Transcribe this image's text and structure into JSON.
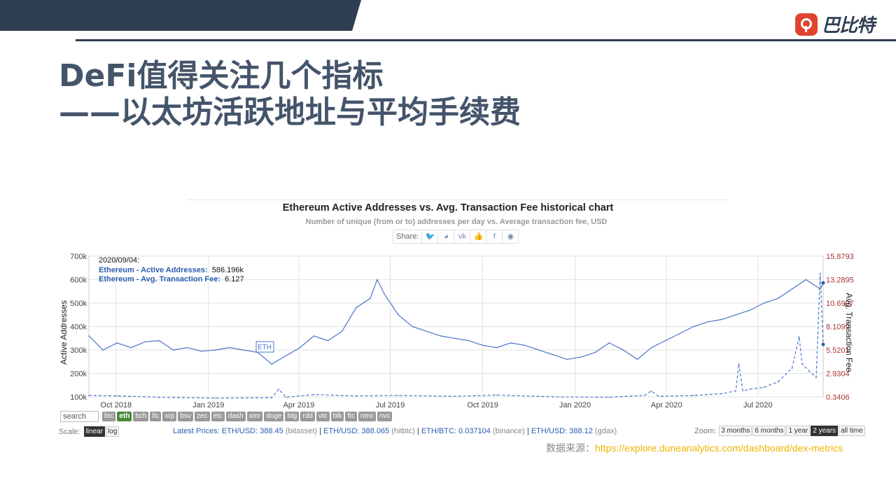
{
  "slide": {
    "title_line1": "DeFi值得关注几个指标",
    "title_line2": "——以太坊活跃地址与平均手续费",
    "logo_text": "巴比特",
    "accent_color": "#2f3d52",
    "logo_color": "#e0442e"
  },
  "chart_data": {
    "type": "line",
    "title": "Ethereum Active Addresses vs. Avg. Transaction Fee historical chart",
    "subtitle": "Number of unique (from or to) addresses per day vs. Average transaction fee, USD",
    "ylabel": "Active Addresses",
    "y2label": "Avg. Transaction Fee",
    "y_ticks": [
      "100k",
      "200k",
      "300k",
      "400k",
      "500k",
      "600k",
      "700k"
    ],
    "y_range": [
      100000,
      700000
    ],
    "y2_ticks": [
      "0.3406",
      "2.9304",
      "5.5201",
      "8.1099",
      "10.6997",
      "13.2895",
      "15.8793"
    ],
    "y2_range": [
      0.3406,
      15.8793
    ],
    "x_ticks": [
      "Oct 2018",
      "Jan 2019",
      "Apr 2019",
      "Jul 2019",
      "Oct 2019",
      "Jan 2020",
      "Apr 2020",
      "Jul 2020"
    ],
    "x_range": [
      "2018-09-04",
      "2020-09-04"
    ],
    "grid": true,
    "series": [
      {
        "name": "Ethereum - Active Addresses",
        "color": "#4a74c9",
        "style": "solid",
        "axis": "left",
        "points": [
          [
            "2018-09-04",
            360000
          ],
          [
            "2018-09-18",
            300000
          ],
          [
            "2018-10-02",
            330000
          ],
          [
            "2018-10-16",
            310000
          ],
          [
            "2018-10-30",
            335000
          ],
          [
            "2018-11-13",
            340000
          ],
          [
            "2018-11-27",
            300000
          ],
          [
            "2018-12-11",
            310000
          ],
          [
            "2018-12-25",
            295000
          ],
          [
            "2019-01-08",
            300000
          ],
          [
            "2019-01-22",
            310000
          ],
          [
            "2019-02-05",
            300000
          ],
          [
            "2019-02-19",
            290000
          ],
          [
            "2019-03-05",
            240000
          ],
          [
            "2019-03-19",
            275000
          ],
          [
            "2019-04-02",
            310000
          ],
          [
            "2019-04-16",
            360000
          ],
          [
            "2019-04-30",
            340000
          ],
          [
            "2019-05-14",
            380000
          ],
          [
            "2019-05-28",
            480000
          ],
          [
            "2019-06-11",
            520000
          ],
          [
            "2019-06-18",
            600000
          ],
          [
            "2019-06-25",
            540000
          ],
          [
            "2019-07-09",
            450000
          ],
          [
            "2019-07-23",
            400000
          ],
          [
            "2019-08-06",
            380000
          ],
          [
            "2019-08-20",
            360000
          ],
          [
            "2019-09-03",
            350000
          ],
          [
            "2019-09-17",
            340000
          ],
          [
            "2019-10-01",
            320000
          ],
          [
            "2019-10-15",
            310000
          ],
          [
            "2019-10-29",
            330000
          ],
          [
            "2019-11-12",
            320000
          ],
          [
            "2019-11-26",
            300000
          ],
          [
            "2019-12-10",
            280000
          ],
          [
            "2019-12-24",
            260000
          ],
          [
            "2020-01-07",
            270000
          ],
          [
            "2020-01-21",
            290000
          ],
          [
            "2020-02-04",
            330000
          ],
          [
            "2020-02-18",
            300000
          ],
          [
            "2020-03-03",
            260000
          ],
          [
            "2020-03-17",
            310000
          ],
          [
            "2020-03-31",
            340000
          ],
          [
            "2020-04-14",
            370000
          ],
          [
            "2020-04-28",
            400000
          ],
          [
            "2020-05-12",
            420000
          ],
          [
            "2020-05-26",
            430000
          ],
          [
            "2020-06-09",
            450000
          ],
          [
            "2020-06-23",
            470000
          ],
          [
            "2020-07-07",
            500000
          ],
          [
            "2020-07-21",
            520000
          ],
          [
            "2020-08-04",
            560000
          ],
          [
            "2020-08-18",
            600000
          ],
          [
            "2020-09-01",
            560000
          ],
          [
            "2020-09-04",
            586196
          ]
        ]
      },
      {
        "name": "Ethereum - Avg. Transaction Fee",
        "color": "#4a74c9",
        "style": "dashed",
        "axis": "right",
        "points": [
          [
            "2018-09-04",
            0.5
          ],
          [
            "2018-10-02",
            0.45
          ],
          [
            "2018-11-13",
            0.3
          ],
          [
            "2019-01-08",
            0.2
          ],
          [
            "2019-03-05",
            0.25
          ],
          [
            "2019-03-12",
            1.2
          ],
          [
            "2019-03-19",
            0.3
          ],
          [
            "2019-04-16",
            0.6
          ],
          [
            "2019-05-28",
            0.45
          ],
          [
            "2019-07-09",
            0.5
          ],
          [
            "2019-09-03",
            0.4
          ],
          [
            "2019-10-15",
            0.55
          ],
          [
            "2019-12-10",
            0.35
          ],
          [
            "2020-02-04",
            0.3
          ],
          [
            "2020-03-10",
            0.5
          ],
          [
            "2020-03-17",
            1.0
          ],
          [
            "2020-03-24",
            0.4
          ],
          [
            "2020-04-28",
            0.5
          ],
          [
            "2020-05-26",
            0.7
          ],
          [
            "2020-06-09",
            1.0
          ],
          [
            "2020-06-12",
            4.0
          ],
          [
            "2020-06-16",
            1.0
          ],
          [
            "2020-06-23",
            1.2
          ],
          [
            "2020-07-07",
            1.4
          ],
          [
            "2020-07-21",
            2.0
          ],
          [
            "2020-08-04",
            3.5
          ],
          [
            "2020-08-11",
            7.0
          ],
          [
            "2020-08-14",
            4.0
          ],
          [
            "2020-08-21",
            3.2
          ],
          [
            "2020-08-28",
            2.5
          ],
          [
            "2020-09-01",
            14.0
          ],
          [
            "2020-09-04",
            6.127
          ]
        ]
      }
    ],
    "tooltip": {
      "date": "2020/09/04:",
      "line1_label": "Ethereum - Active Addresses:",
      "line1_value": "586.196k",
      "line2_label": "Ethereum - Avg. Transaction Fee:",
      "line2_value": "6.127"
    },
    "annotation": "ETH"
  },
  "share": {
    "label": "Share:"
  },
  "controls": {
    "search_placeholder": "search",
    "coins": [
      "btc",
      "eth",
      "bch",
      "ltc",
      "xrp",
      "bsv",
      "zec",
      "etc",
      "dash",
      "xmr",
      "doge",
      "btg",
      "rdd",
      "vtc",
      "blk",
      "ftc",
      "nmc",
      "nvc"
    ],
    "active_coin": "eth",
    "scale_label": "Scale:",
    "scale_options": [
      "linear",
      "log"
    ],
    "zoom_label": "Zoom:",
    "zoom_options": [
      "3 months",
      "6 months",
      "1 year",
      "2 years",
      "all time"
    ]
  },
  "prices": {
    "label": "Latest Prices:",
    "items": [
      {
        "pair": "ETH/USD:",
        "value": "388.45",
        "exchange": "(bitasset)"
      },
      {
        "pair": "ETH/USD:",
        "value": "388.065",
        "exchange": "(hitbtc)"
      },
      {
        "pair": "ETH/BTC:",
        "value": "0.037104",
        "exchange": "(binance)"
      },
      {
        "pair": "ETH/USD:",
        "value": "388.12",
        "exchange": "(gdax)"
      }
    ]
  },
  "source": {
    "label": "数据来源：",
    "url": "https://explore.duneanalytics.com/dashboard/dex-metrics"
  }
}
